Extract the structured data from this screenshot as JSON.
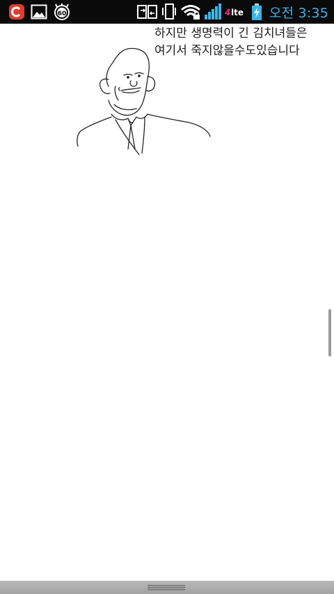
{
  "status_bar": {
    "time": "오전 3:35",
    "network_label": "4G LTE",
    "accent_color": "#38b6e8",
    "icons": [
      "app-icon",
      "gallery-icon",
      "fps-icon",
      "screen-share-icon",
      "vibrate-icon",
      "wifi-icon",
      "signal-icon",
      "lte-icon",
      "battery-charging-icon"
    ]
  },
  "content": {
    "caption_lines": [
      "하지만 생명력이 긴 김치녀들은",
      "여기서 죽지않을수도있습니다"
    ],
    "image": "line-drawing-man"
  }
}
